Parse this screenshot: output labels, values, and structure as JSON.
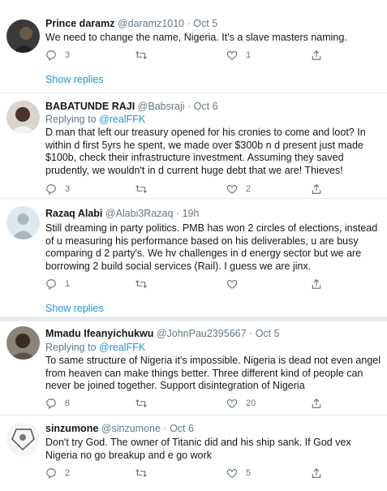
{
  "tweets": [
    {
      "name": "Prince daramz",
      "handle": "@daramz1010",
      "date": "Oct 5",
      "text": "We need to change the name, Nigeria. It's a slave masters naming.",
      "replies": "3",
      "retweets": "",
      "likes": "1",
      "show_replies": "Show replies"
    },
    {
      "name": "BABATUNDE RAJI",
      "handle": "@Babsraji",
      "date": "Oct 6",
      "replying_to_prefix": "Replying to",
      "replying_to": "@realFFK",
      "text": "D man that left our treasury opened for his cronies to come and loot? In within d first 5yrs he spent, we made over $300b n d present just made $100b, check their infrastructure investment. Assuming they saved prudently, we wouldn't in d current huge debt that we are! Thieves!",
      "replies": "3",
      "retweets": "",
      "likes": "2"
    },
    {
      "name": "Razaq Alabi",
      "handle": "@Alabi3Razaq",
      "date": "19h",
      "text": "Still dreaming in party politics. PMB has won 2 circles of elections, instead of u measuring his performance based on his deliverables, u are busy comparing d 2 party's. We hv challenges in d energy sector but we are borrowing 2 build social services (Rail). I guess we are jinx.",
      "replies": "1",
      "retweets": "",
      "likes": "",
      "show_replies": "Show replies"
    },
    {
      "name": "Mmadu Ifeanyichukwu",
      "handle": "@JohnPau2395667",
      "date": "Oct 5",
      "replying_to_prefix": "Replying to",
      "replying_to": "@realFFK",
      "text": "To same structure of Nigeria it's impossible. Nigeria is dead not even angel from heaven can make things better. Three different kind of people can never be joined together. Support disintegration of Nigeria",
      "replies": "8",
      "retweets": "",
      "likes": "20"
    },
    {
      "name": "sinzumone",
      "handle": "@sinzumone",
      "date": "Oct 6",
      "text": "Don't try God. The owner of Titanic did and his ship sank. If God vex Nigeria no go breakup and e go work",
      "replies": "2",
      "retweets": "",
      "likes": "5"
    }
  ],
  "separator_dot": "·",
  "icons": [
    "reply-icon",
    "retweet-icon",
    "like-icon",
    "share-icon"
  ],
  "colors": {
    "link": "#1b95e0",
    "muted": "#657786",
    "text": "#14171a",
    "border": "#e6ecf0"
  }
}
